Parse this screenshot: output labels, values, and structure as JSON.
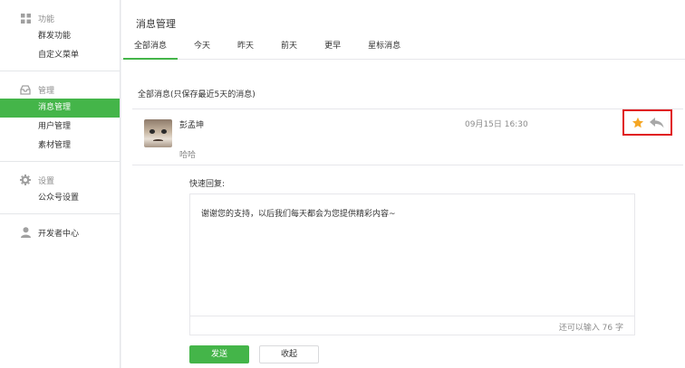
{
  "sidebar": {
    "groups": [
      {
        "title": "功能",
        "icon": "grid-icon",
        "items": [
          "群发功能",
          "自定义菜单"
        ]
      },
      {
        "title": "管理",
        "icon": "inbox-icon",
        "items": [
          "消息管理",
          "用户管理",
          "素材管理"
        ]
      },
      {
        "title": "设置",
        "icon": "gear-icon",
        "items": [
          "公众号设置"
        ]
      },
      {
        "title": "开发者中心",
        "icon": "person-icon",
        "items": []
      }
    ],
    "active_item": "消息管理"
  },
  "main": {
    "title": "消息管理",
    "tabs": [
      "全部消息",
      "今天",
      "昨天",
      "前天",
      "更早",
      "星标消息"
    ],
    "active_tab": "全部消息",
    "section_label": "全部消息(只保存最近5天的消息)"
  },
  "message": {
    "user_name": "彭孟坤",
    "text": "哈哈",
    "time": "09月15日 16:30",
    "star_color": "#f5a623",
    "reply_icon_color": "#999999"
  },
  "reply": {
    "label": "快速回复:",
    "text": "谢谢您的支持，以后我们每天都会为您提供精彩内容~",
    "counter": "还可以输入 76 字",
    "send_label": "发送",
    "collapse_label": "收起"
  },
  "colors": {
    "accent": "#44b549",
    "highlight_border": "#e0171b"
  }
}
